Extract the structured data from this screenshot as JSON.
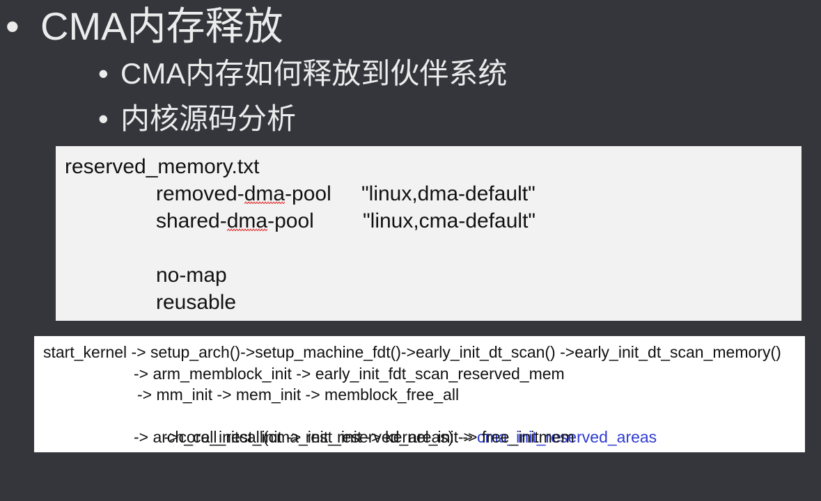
{
  "slide": {
    "bullet": "•",
    "title": "CMA内存释放",
    "subbullets": [
      "CMA内存如何释放到伙伴系统",
      "内核源码分析"
    ]
  },
  "config_box": {
    "filename": "reserved_memory.txt",
    "rows": [
      {
        "name": "removed-dma-pool",
        "compatible": "\"linux,dma-default\""
      },
      {
        "name": "shared-dma-pool",
        "compatible": "\"linux,cma-default\""
      }
    ],
    "properties": [
      "no-map",
      "reusable"
    ]
  },
  "call_chain": {
    "lines": [
      "start_kernel -> setup_arch()->setup_machine_fdt()->early_init_dt_scan() ->early_init_dt_scan_memory()",
      "-> arm_memblock_init -> early_init_fdt_scan_reserved_mem",
      "-> mm_init -> mem_init -> memblock_free_all",
      "->core_initcall(cma_init_reserved_areas) ->",
      "-> arch_call_rest_init -> rest_init -> kernel_init -> free_initmem"
    ],
    "highlight": "cma_init_reserved_areas"
  },
  "colors": {
    "background": "#34363c",
    "foreground": "#ececec",
    "config_box": "#f2f2f2",
    "call_chain_box": "#ffffff",
    "highlight": "#2d3bd2",
    "spellcheck_underline": "#e02020"
  }
}
